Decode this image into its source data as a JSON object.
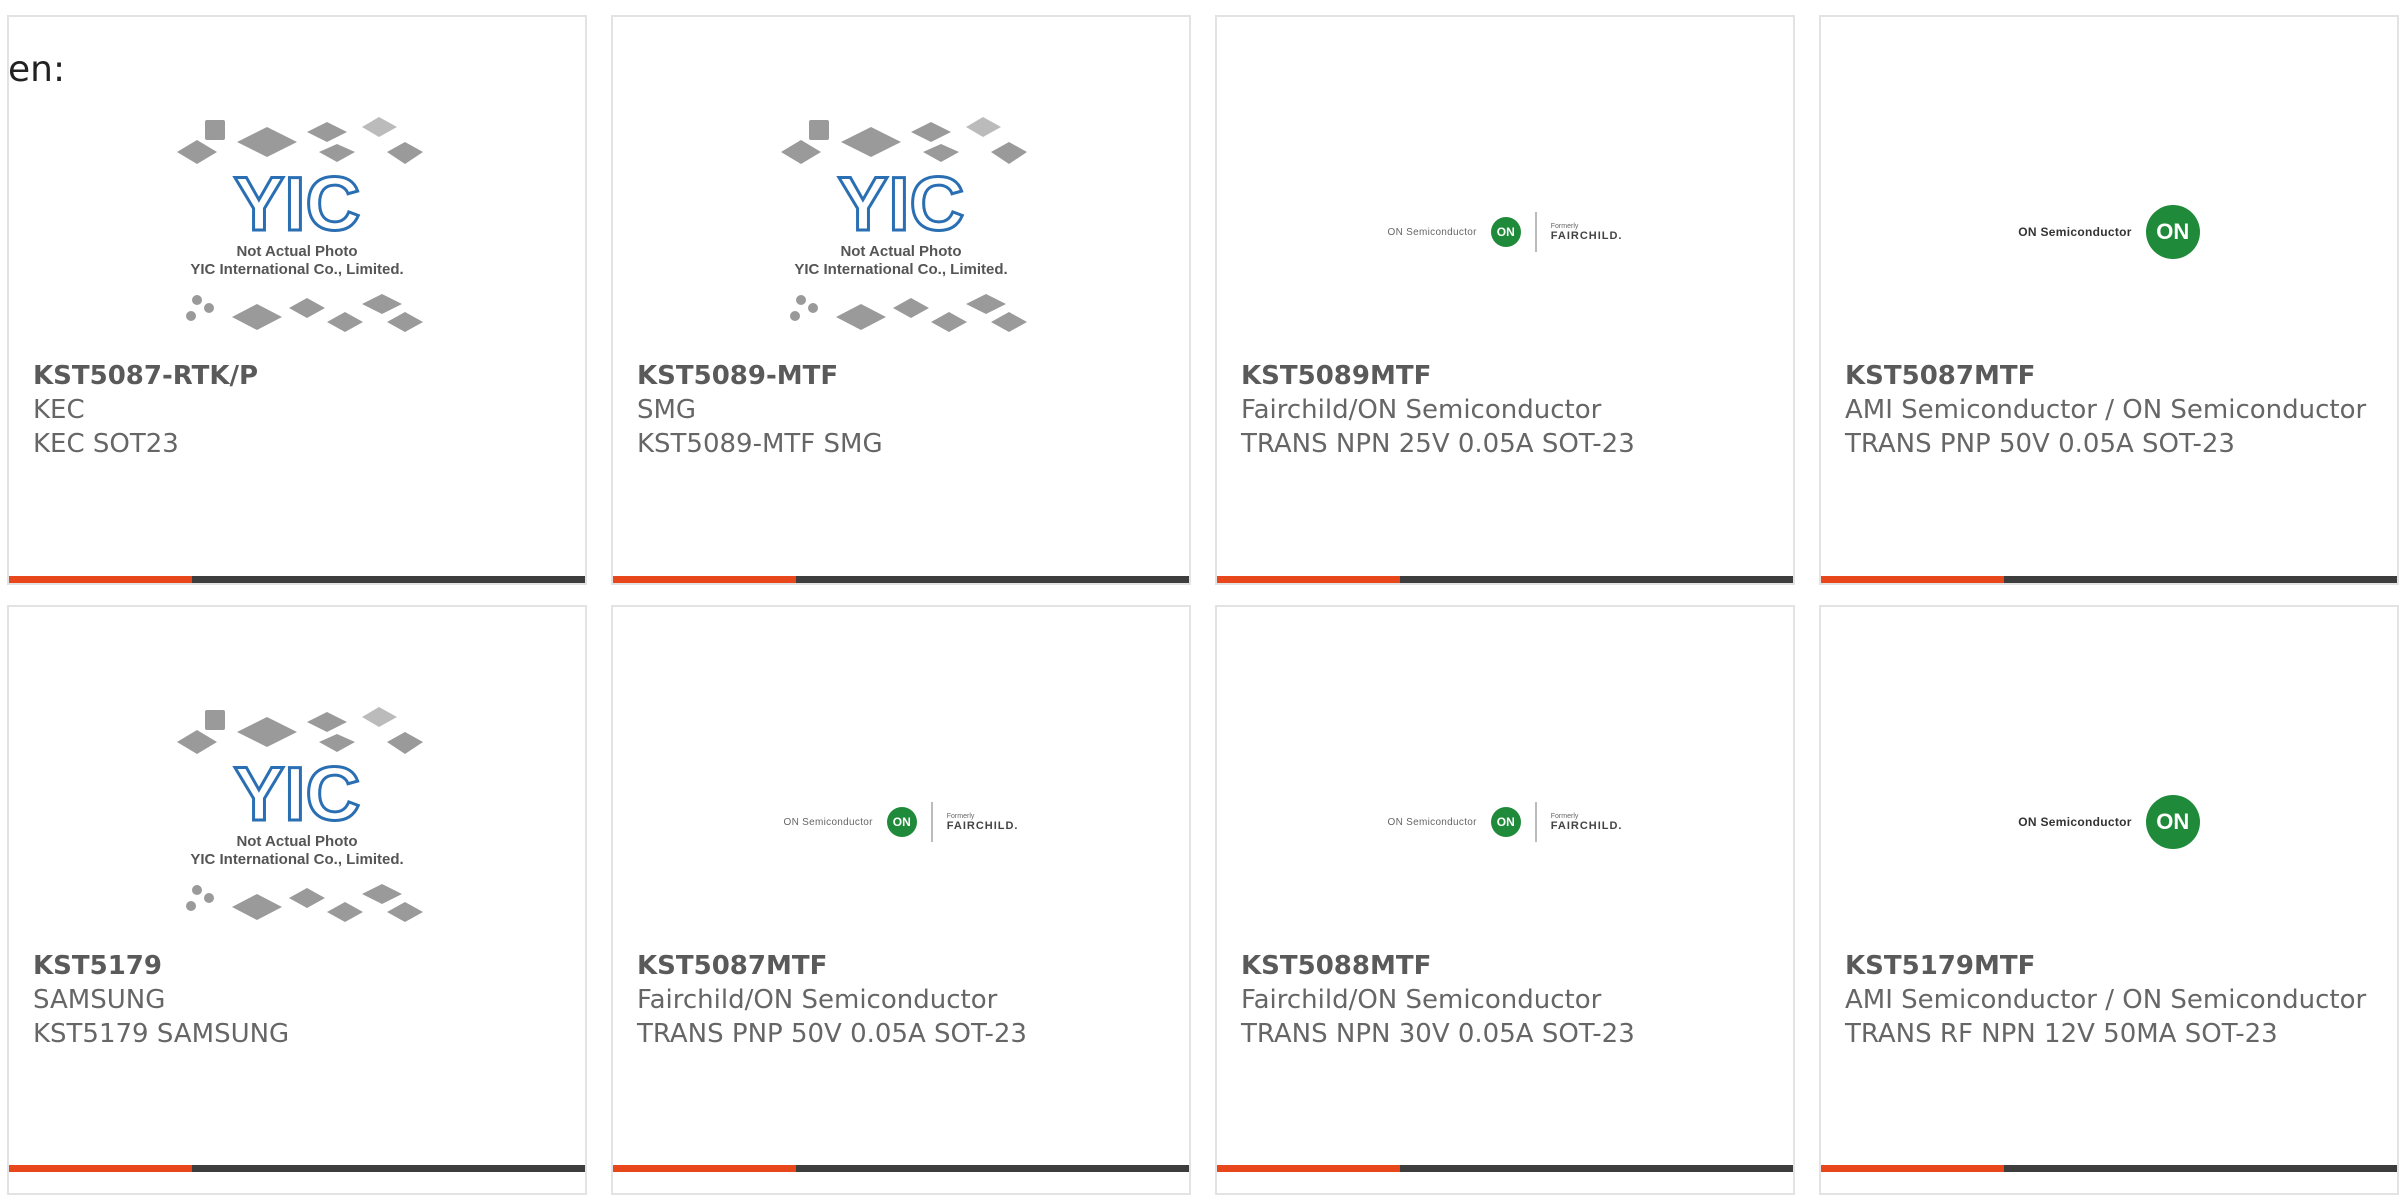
{
  "lang_label": "en:",
  "logo_text": {
    "yic_caption_line1": "Not Actual Photo",
    "yic_caption_line2": "YIC International Co., Limited.",
    "yic_letters": "YIC",
    "on_badge": "ON",
    "on_semiconductor": "ON Semiconductor",
    "formerly": "Formerly",
    "fairchild": "FAIRCHILD."
  },
  "products": [
    {
      "part": "KST5087-RTK/P",
      "manufacturer": "KEC",
      "description": "KEC SOT23",
      "logo": "yic-placeholder"
    },
    {
      "part": "KST5089-MTF",
      "manufacturer": "SMG",
      "description": "KST5089-MTF SMG",
      "logo": "yic-placeholder"
    },
    {
      "part": "KST5089MTF",
      "manufacturer": "Fairchild/ON Semiconductor",
      "description": "TRANS NPN 25V 0.05A SOT-23",
      "logo": "on-fairchild"
    },
    {
      "part": "KST5087MTF",
      "manufacturer": "AMI Semiconductor / ON Semiconductor",
      "description": "TRANS PNP 50V 0.05A SOT-23",
      "logo": "on-semi"
    },
    {
      "part": "KST5179",
      "manufacturer": "SAMSUNG",
      "description": "KST5179 SAMSUNG",
      "logo": "yic-placeholder"
    },
    {
      "part": "KST5087MTF",
      "manufacturer": "Fairchild/ON Semiconductor",
      "description": "TRANS PNP 50V 0.05A SOT-23",
      "logo": "on-fairchild"
    },
    {
      "part": "KST5088MTF",
      "manufacturer": "Fairchild/ON Semiconductor",
      "description": "TRANS NPN 30V 0.05A SOT-23",
      "logo": "on-fairchild"
    },
    {
      "part": "KST5179MTF",
      "manufacturer": "AMI Semiconductor / ON Semiconductor",
      "description": "TRANS RF NPN 12V 50MA SOT-23",
      "logo": "on-semi"
    }
  ],
  "colors": {
    "accent": "#e8471b",
    "bar": "#3d3d3d",
    "border": "#e3e3e3",
    "on_green": "#1f8a3a",
    "yic_blue": "#2a6fb3"
  }
}
